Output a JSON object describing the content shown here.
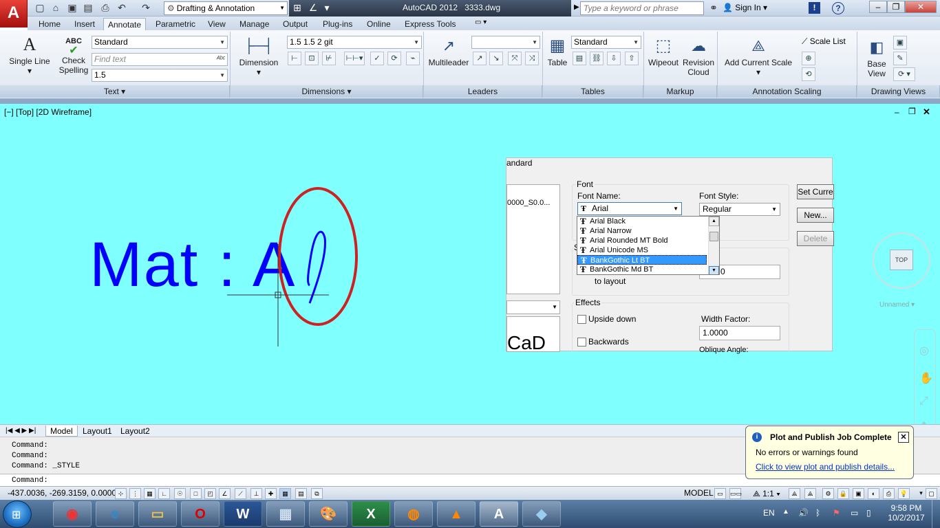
{
  "title": {
    "workspace": "Drafting & Annotation",
    "app_title": "AutoCAD 2012",
    "file_name": "3333.dwg",
    "search_placeholder": "Type a keyword or phrase",
    "sign_in": "Sign In"
  },
  "tabs": [
    {
      "label": "Home"
    },
    {
      "label": "Insert"
    },
    {
      "label": "Annotate"
    },
    {
      "label": "Parametric"
    },
    {
      "label": "View"
    },
    {
      "label": "Manage"
    },
    {
      "label": "Output"
    },
    {
      "label": "Plug-ins"
    },
    {
      "label": "Online"
    },
    {
      "label": "Express Tools"
    }
  ],
  "ribbon": {
    "text": {
      "single_line": "Single Line",
      "check": "Check",
      "spelling": "Spelling",
      "abc": "ABC",
      "style": "Standard",
      "find_placeholder": "Find text",
      "height": "1.5",
      "panel": "Text"
    },
    "dimensions": {
      "dimension": "Dimension",
      "style": "1.5 1.5  2 git",
      "panel": "Dimensions"
    },
    "leaders": {
      "multileader": "Multileader",
      "panel": "Leaders"
    },
    "tables": {
      "table": "Table",
      "style": "Standard",
      "panel": "Tables"
    },
    "markup": {
      "wipeout": "Wipeout",
      "revision": "Revision",
      "cloud": "Cloud",
      "panel": "Markup"
    },
    "annotation_scaling": {
      "add_current_scale": "Add Current Scale",
      "scale_list": "Scale List",
      "panel": "Annotation Scaling"
    },
    "drawing_views": {
      "base": "Base",
      "view": "View",
      "panel": "Drawing Views"
    }
  },
  "viewport": {
    "label": "[−] [Top] [2D Wireframe]",
    "drawing_text": "Mat : A",
    "cube_face": "TOP",
    "ucs_name": "Unnamed"
  },
  "dialog": {
    "title_fragment": "andard",
    "style_item": "0000_S0.0...",
    "font_group": "Font",
    "font_name_label": "Font Name:",
    "font_name_value": "Arial",
    "font_style_label": "Font Style:",
    "font_style_value": "Regular",
    "font_list": [
      "Arial Black",
      "Arial Narrow",
      "Arial Rounded MT Bold",
      "Arial Unicode MS",
      "BankGothic Lt BT",
      "BankGothic Md BT"
    ],
    "selected_font": "BankGothic Lt BT",
    "set_current": "Set Curre",
    "new": "New...",
    "delete": "Delete",
    "size_fragment": "S",
    "to_layout": "to layout",
    "height_fragment": "0",
    "effects_group": "Effects",
    "upside_down": "Upside down",
    "backwards": "Backwards",
    "width_factor_label": "Width Factor:",
    "width_factor": "1.0000",
    "oblique_label": "Oblique Angle:",
    "preview_text": "CaD"
  },
  "layouts": [
    "Model",
    "Layout1",
    "Layout2"
  ],
  "command": {
    "history": [
      "Command:",
      "Command:",
      "Command:  _STYLE"
    ],
    "prompt": "Command:"
  },
  "status": {
    "coords": "-437.0036, -269.3159, 0.0000",
    "model": "MODEL",
    "scale": "1:1"
  },
  "balloon": {
    "title": "Plot and Publish Job Complete",
    "body": "No errors or warnings found",
    "link": "Click to view plot and publish details..."
  },
  "taskbar": {
    "lang": "EN",
    "time": "9:58 PM",
    "date": "10/2/2017"
  },
  "colors": {
    "viewport_bg": "#80ffff",
    "drawing_text": "#0000ff",
    "circle": "#cc2222"
  }
}
